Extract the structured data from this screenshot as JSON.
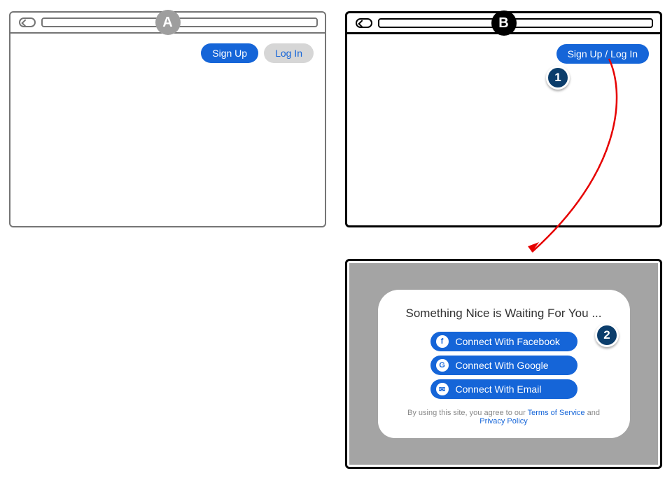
{
  "frames": {
    "a": {
      "label": "A"
    },
    "b": {
      "label": "B"
    },
    "b_modal": {}
  },
  "header_a": {
    "signup_label": "Sign Up",
    "login_label": "Log In"
  },
  "header_b": {
    "combined_label": "Sign Up / Log In"
  },
  "steps": {
    "one": "1",
    "two": "2"
  },
  "modal": {
    "title": "Something Nice is Waiting For You ...",
    "buttons": [
      {
        "icon": "facebook-icon",
        "glyph": "f",
        "label": "Connect With Facebook"
      },
      {
        "icon": "google-icon",
        "glyph": "G",
        "label": "Connect With Google"
      },
      {
        "icon": "email-icon",
        "glyph": "✉",
        "label": "Connect With Email"
      }
    ],
    "legal_prefix": "By using this site, you agree to our ",
    "tos_label": "Terms of Service",
    "legal_mid": " and ",
    "privacy_label": "Privacy Policy"
  }
}
